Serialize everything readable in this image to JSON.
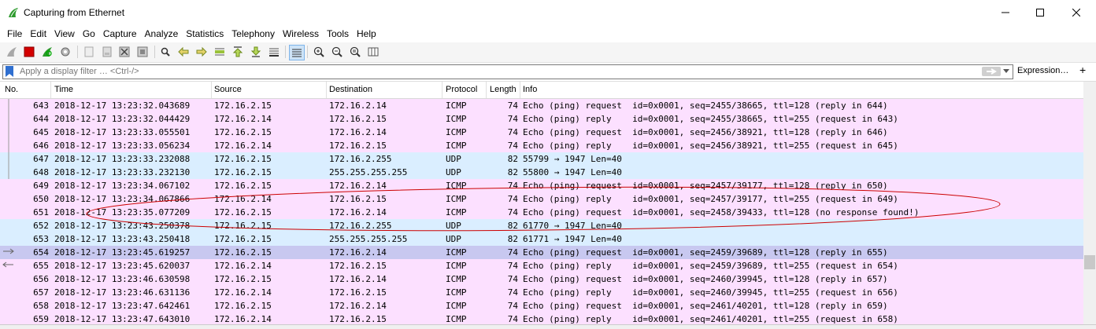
{
  "window": {
    "title": "Capturing from Ethernet",
    "icon": "wireshark-fin-icon"
  },
  "menu": [
    "File",
    "Edit",
    "View",
    "Go",
    "Capture",
    "Analyze",
    "Statistics",
    "Telephony",
    "Wireless",
    "Tools",
    "Help"
  ],
  "filter": {
    "placeholder": "Apply a display filter … <Ctrl-/>",
    "expression_label": "Expression…",
    "plus_label": "+"
  },
  "columns": [
    "No.",
    "Time",
    "Source",
    "Destination",
    "Protocol",
    "Length",
    "Info"
  ],
  "packets": [
    {
      "no": "643",
      "time": "2018-12-17 13:23:32.043689",
      "src": "172.16.2.15",
      "dst": "172.16.2.14",
      "proto": "ICMP",
      "len": "74",
      "info": "Echo (ping) request  id=0x0001, seq=2455/38665, ttl=128 (reply in 644)",
      "type": "icmp"
    },
    {
      "no": "644",
      "time": "2018-12-17 13:23:32.044429",
      "src": "172.16.2.14",
      "dst": "172.16.2.15",
      "proto": "ICMP",
      "len": "74",
      "info": "Echo (ping) reply    id=0x0001, seq=2455/38665, ttl=255 (request in 643)",
      "type": "icmp"
    },
    {
      "no": "645",
      "time": "2018-12-17 13:23:33.055501",
      "src": "172.16.2.15",
      "dst": "172.16.2.14",
      "proto": "ICMP",
      "len": "74",
      "info": "Echo (ping) request  id=0x0001, seq=2456/38921, ttl=128 (reply in 646)",
      "type": "icmp"
    },
    {
      "no": "646",
      "time": "2018-12-17 13:23:33.056234",
      "src": "172.16.2.14",
      "dst": "172.16.2.15",
      "proto": "ICMP",
      "len": "74",
      "info": "Echo (ping) reply    id=0x0001, seq=2456/38921, ttl=255 (request in 645)",
      "type": "icmp"
    },
    {
      "no": "647",
      "time": "2018-12-17 13:23:33.232088",
      "src": "172.16.2.15",
      "dst": "172.16.2.255",
      "proto": "UDP",
      "len": "82",
      "info": "55799 → 1947 Len=40",
      "type": "udp"
    },
    {
      "no": "648",
      "time": "2018-12-17 13:23:33.232130",
      "src": "172.16.2.15",
      "dst": "255.255.255.255",
      "proto": "UDP",
      "len": "82",
      "info": "55800 → 1947 Len=40",
      "type": "udp"
    },
    {
      "no": "649",
      "time": "2018-12-17 13:23:34.067102",
      "src": "172.16.2.15",
      "dst": "172.16.2.14",
      "proto": "ICMP",
      "len": "74",
      "info": "Echo (ping) request  id=0x0001, seq=2457/39177, ttl=128 (reply in 650)",
      "type": "icmp"
    },
    {
      "no": "650",
      "time": "2018-12-17 13:23:34.067866",
      "src": "172.16.2.14",
      "dst": "172.16.2.15",
      "proto": "ICMP",
      "len": "74",
      "info": "Echo (ping) reply    id=0x0001, seq=2457/39177, ttl=255 (request in 649)",
      "type": "icmp"
    },
    {
      "no": "651",
      "time": "2018-12-17 13:23:35.077209",
      "src": "172.16.2.15",
      "dst": "172.16.2.14",
      "proto": "ICMP",
      "len": "74",
      "info": "Echo (ping) request  id=0x0001, seq=2458/39433, ttl=128 (no response found!)",
      "type": "icmp"
    },
    {
      "no": "652",
      "time": "2018-12-17 13:23:43.250378",
      "src": "172.16.2.15",
      "dst": "172.16.2.255",
      "proto": "UDP",
      "len": "82",
      "info": "61770 → 1947 Len=40",
      "type": "udp"
    },
    {
      "no": "653",
      "time": "2018-12-17 13:23:43.250418",
      "src": "172.16.2.15",
      "dst": "255.255.255.255",
      "proto": "UDP",
      "len": "82",
      "info": "61771 → 1947 Len=40",
      "type": "udp"
    },
    {
      "no": "654",
      "time": "2018-12-17 13:23:45.619257",
      "src": "172.16.2.15",
      "dst": "172.16.2.14",
      "proto": "ICMP",
      "len": "74",
      "info": "Echo (ping) request  id=0x0001, seq=2459/39689, ttl=128 (reply in 655)",
      "type": "selected"
    },
    {
      "no": "655",
      "time": "2018-12-17 13:23:45.620037",
      "src": "172.16.2.14",
      "dst": "172.16.2.15",
      "proto": "ICMP",
      "len": "74",
      "info": "Echo (ping) reply    id=0x0001, seq=2459/39689, ttl=255 (request in 654)",
      "type": "icmp"
    },
    {
      "no": "656",
      "time": "2018-12-17 13:23:46.630598",
      "src": "172.16.2.15",
      "dst": "172.16.2.14",
      "proto": "ICMP",
      "len": "74",
      "info": "Echo (ping) request  id=0x0001, seq=2460/39945, ttl=128 (reply in 657)",
      "type": "icmp"
    },
    {
      "no": "657",
      "time": "2018-12-17 13:23:46.631136",
      "src": "172.16.2.14",
      "dst": "172.16.2.15",
      "proto": "ICMP",
      "len": "74",
      "info": "Echo (ping) reply    id=0x0001, seq=2460/39945, ttl=255 (request in 656)",
      "type": "icmp"
    },
    {
      "no": "658",
      "time": "2018-12-17 13:23:47.642461",
      "src": "172.16.2.15",
      "dst": "172.16.2.14",
      "proto": "ICMP",
      "len": "74",
      "info": "Echo (ping) request  id=0x0001, seq=2461/40201, ttl=128 (reply in 659)",
      "type": "icmp"
    },
    {
      "no": "659",
      "time": "2018-12-17 13:23:47.643010",
      "src": "172.16.2.14",
      "dst": "172.16.2.15",
      "proto": "ICMP",
      "len": "74",
      "info": "Echo (ping) reply    id=0x0001, seq=2461/40201, ttl=255 (request in 658)",
      "type": "icmp"
    }
  ],
  "row_colors": {
    "icmp": "#fce0ff",
    "udp": "#daeeff",
    "selected": "#c8c8f0"
  },
  "annotation_color": "#cc0000",
  "toolbar_icons": [
    "shark-fin-start-icon",
    "stop-icon",
    "restart-icon",
    "options-gear-icon",
    "open-file-icon",
    "save-file-icon",
    "close-file-icon",
    "reload-icon",
    "find-packet-icon",
    "go-back-icon",
    "go-forward-icon",
    "go-to-packet-icon",
    "go-first-icon",
    "go-last-icon",
    "autoscroll-icon",
    "colorize-icon",
    "zoom-in-icon",
    "zoom-out-icon",
    "normal-size-icon",
    "resize-columns-icon"
  ]
}
